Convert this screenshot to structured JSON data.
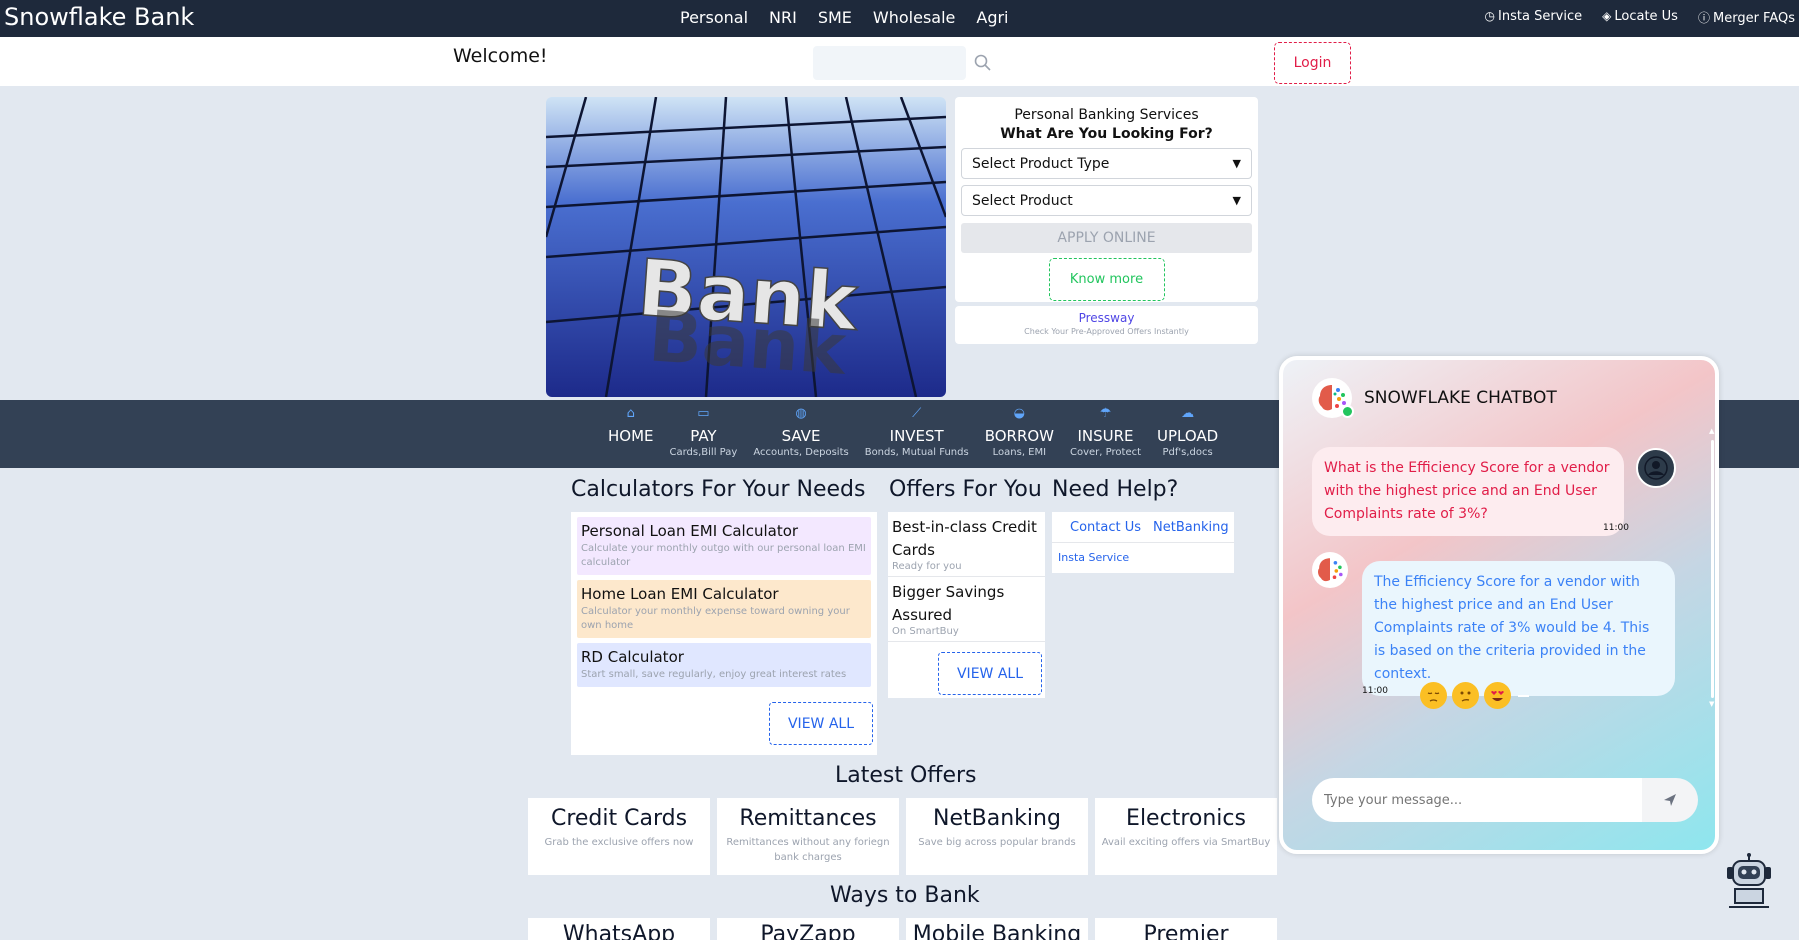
{
  "topbar": {
    "brand": "Snowflake Bank",
    "nav": [
      "Personal",
      "NRI",
      "SME",
      "Wholesale",
      "Agri"
    ],
    "links": [
      {
        "icon": "clock-icon",
        "label": "Insta Service"
      },
      {
        "icon": "location-icon",
        "label": "Locate Us"
      },
      {
        "icon": "question-icon",
        "label": "Merger FAQs"
      }
    ]
  },
  "subbar": {
    "welcome": "Welcome!",
    "search_placeholder": "",
    "login": "Login"
  },
  "hero": {
    "image_text": "Bank"
  },
  "services": {
    "title": "Personal Banking Services",
    "subtitle": "What Are You Looking For?",
    "select_type": "Select Product Type",
    "select_product": "Select Product",
    "apply": "APPLY ONLINE",
    "know_more": "Know more",
    "pressway_title": "Pressway",
    "pressway_sub": "Check Your Pre-Approved Offers Instantly"
  },
  "nav": [
    {
      "label": "HOME",
      "sub": ""
    },
    {
      "label": "PAY",
      "sub": "Cards,Bill Pay"
    },
    {
      "label": "SAVE",
      "sub": "Accounts, Deposits"
    },
    {
      "label": "INVEST",
      "sub": "Bonds, Mutual Funds"
    },
    {
      "label": "BORROW",
      "sub": "Loans, EMI"
    },
    {
      "label": "INSURE",
      "sub": "Cover, Protect"
    },
    {
      "label": "UPLOAD",
      "sub": "Pdf's,docs"
    }
  ],
  "calculators": {
    "heading": "Calculators For Your Needs",
    "items": [
      {
        "title": "Personal Loan EMI Calculator",
        "desc": "Calculate your monthly outgo with our personal loan EMI calculator",
        "color": "#f3e8ff"
      },
      {
        "title": "Home Loan EMI Calculator",
        "desc": "Calculator your monthly expense toward owning your own home",
        "color": "#fde8cc"
      },
      {
        "title": "RD Calculator",
        "desc": "Start small, save regularly, enjoy great interest rates",
        "color": "#e0e7ff"
      }
    ],
    "view_all": "VIEW ALL"
  },
  "offers": {
    "heading": "Offers For You",
    "items": [
      {
        "title": "Best-in-class Credit Cards",
        "desc": "Ready for you"
      },
      {
        "title": "Bigger Savings Assured",
        "desc": "On SmartBuy"
      }
    ],
    "view_all": "VIEW ALL"
  },
  "help": {
    "heading": "Need Help?",
    "tabs": [
      "Contact Us",
      "NetBanking"
    ],
    "body": "Insta Service"
  },
  "latest": {
    "heading": "Latest Offers",
    "cards": [
      {
        "title": "Credit Cards",
        "desc": "Grab the exclusive offers now"
      },
      {
        "title": "Remittances",
        "desc": "Remittances without any foriegn bank charges"
      },
      {
        "title": "NetBanking",
        "desc": "Save big across popular brands"
      },
      {
        "title": "Electronics",
        "desc": "Avail exciting offers via SmartBuy"
      }
    ]
  },
  "ways": {
    "heading": "Ways to Bank",
    "cards": [
      "WhatsApp",
      "PayZapp",
      "Mobile Banking",
      "Premier"
    ]
  },
  "chat": {
    "title": "SNOWFLAKE CHATBOT",
    "user_msg": "What is the Efficiency Score for a vendor with the highest price and an End User Complaints rate of 3%?",
    "user_time": "11:00",
    "bot_msg": "The Efficiency Score for a vendor with the highest price and an End User Complaints rate of 3% would be 4. This is based on the criteria provided in the context.",
    "bot_time": "11:00",
    "reactions": [
      "pensive-face-icon",
      "confused-face-icon",
      "heart-eyes-face-icon"
    ],
    "input_placeholder": "Type your message..."
  }
}
